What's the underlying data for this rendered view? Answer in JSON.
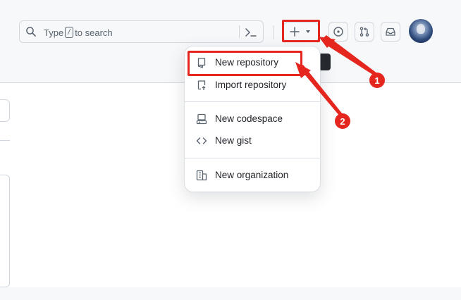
{
  "header": {
    "search": {
      "prefix": "Type",
      "key": "/",
      "suffix": "to search",
      "search_icon": "search-icon",
      "command_icon": "command-palette-icon"
    },
    "create_button_icon": "plus-icon",
    "create_button_caret_icon": "triangle-down-icon",
    "issues_icon": "issue-opened-icon",
    "pull_requests_icon": "git-pull-request-icon",
    "inbox_icon": "inbox-icon",
    "avatar_icon": "user-avatar"
  },
  "create_menu": {
    "items": [
      {
        "label": "New repository",
        "icon": "repo-icon"
      },
      {
        "label": "Import repository",
        "icon": "repo-push-icon"
      },
      {
        "label": "New codespace",
        "icon": "codespaces-icon"
      },
      {
        "label": "New gist",
        "icon": "code-icon"
      },
      {
        "label": "New organization",
        "icon": "organization-icon"
      }
    ]
  },
  "annotations": {
    "step1": "1",
    "step2": "2",
    "color": "#e5261f"
  },
  "colors": {
    "header_bg": "#f6f8fa",
    "border": "#d0d7de",
    "text": "#1f2328",
    "muted": "#59636e",
    "highlight": "#e5261f"
  }
}
